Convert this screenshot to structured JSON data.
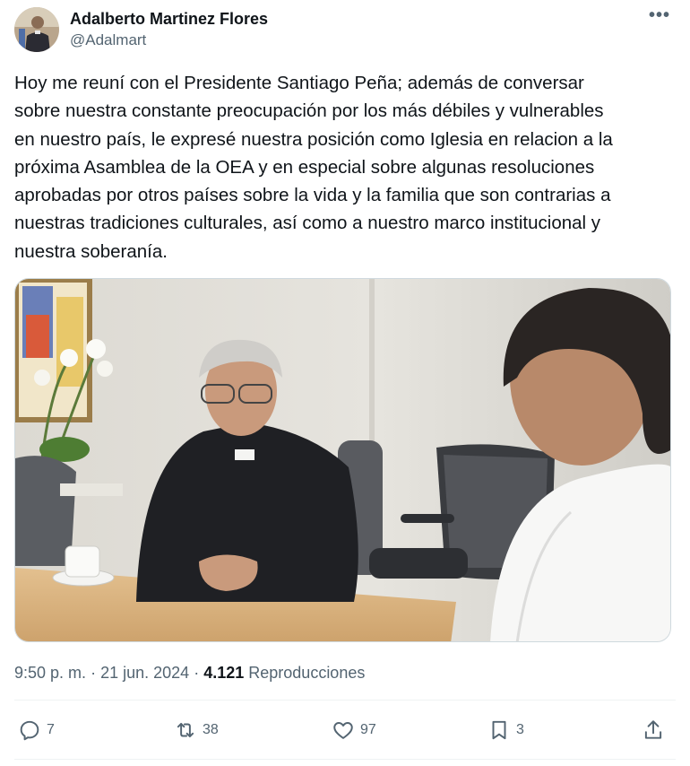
{
  "author": {
    "display_name": "Adalberto Martinez Flores",
    "handle": "@Adalmart"
  },
  "menu_icon": "more-horizontal-icon",
  "tweet": {
    "lines": [
      "Hoy me reuní con el Presidente Santiago Peña; además de conversar",
      "sobre nuestra constante preocupación por los más débiles y vulnerables",
      "en nuestro país, le expresé nuestra posición como Iglesia en relacion a la",
      "próxima Asamblea de la OEA y en especial sobre algunas resoluciones",
      "aprobadas por otros países sobre la vida y la familia que son contrarias a",
      "nuestras tradiciones culturales, así como a nuestro marco institucional y",
      "nuestra soberanía."
    ]
  },
  "meta": {
    "time": "9:50 p. m.",
    "separator": "·",
    "date": "21 jun. 2024",
    "views_count": "4.121",
    "views_label": "Reproducciones"
  },
  "actions": {
    "reply": {
      "icon": "reply-icon",
      "count": "7"
    },
    "retweet": {
      "icon": "retweet-icon",
      "count": "38"
    },
    "like": {
      "icon": "heart-icon",
      "count": "97"
    },
    "bookmark": {
      "icon": "bookmark-icon",
      "count": "3"
    },
    "share": {
      "icon": "share-icon"
    }
  },
  "colors": {
    "text": "#0f1419",
    "secondary": "#536471",
    "divider": "#eff3f4"
  }
}
